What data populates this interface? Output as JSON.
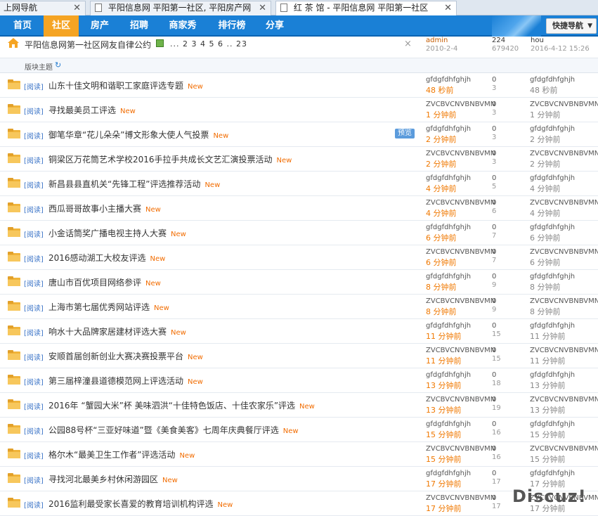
{
  "browser": {
    "tabs": [
      {
        "label": "上网导航"
      },
      {
        "label": "平阳信息网 平阳第一社区, 平阳房产网"
      },
      {
        "label": "红 茶 馆 - 平阳信息网 平阳第一社区"
      }
    ]
  },
  "nav": {
    "items": [
      "首页",
      "社区",
      "房产",
      "招聘",
      "商家秀",
      "排行榜",
      "分享"
    ],
    "active": "社区",
    "quick_nav": "快捷导航"
  },
  "announcement": {
    "title": "平阳信息网第一社区网友自律公约",
    "pager": "... 2 3 4 5 6 .. 23",
    "close": "×",
    "author": "admin",
    "date": "2010-2-4",
    "replies": "224",
    "views": "679420",
    "last_by": "hou",
    "last_time": "2016-4-12 15:26"
  },
  "section": {
    "label": "版块主题"
  },
  "new_label": "New",
  "preview_label": "预览",
  "threads": [
    {
      "cat": "[阅读]",
      "title": "山东十佳文明和谐职工家庭评选专题",
      "author": "gfdgfdhfghjh",
      "atime": "48 秒前",
      "replies": "0",
      "views": "3",
      "last_by": "gfdgfdhfghjh",
      "last_time": "48 秒前"
    },
    {
      "cat": "[阅读]",
      "title": "寻找最美员工评选",
      "author": "ZVCBVCNVBNBVMN",
      "atime": "1 分钟前",
      "replies": "0",
      "views": "3",
      "last_by": "ZVCBVCNVBNBVMN",
      "last_time": "1 分钟前"
    },
    {
      "cat": "[阅读]",
      "title": "御笔华章“花儿朵朵”博文形象大使人气投票",
      "author": "gfdgfdhfghjh",
      "atime": "2 分钟前",
      "replies": "0",
      "views": "3",
      "last_by": "gfdgfdhfghjh",
      "last_time": "2 分钟前",
      "preview": true
    },
    {
      "cat": "[阅读]",
      "title": "铜梁区万花筒艺术学校2016手拉手共成长文艺汇演投票活动",
      "author": "ZVCBVCNVBNBVMN",
      "atime": "2 分钟前",
      "replies": "0",
      "views": "3",
      "last_by": "ZVCBVCNVBNBVMN",
      "last_time": "2 分钟前"
    },
    {
      "cat": "[阅读]",
      "title": "新昌县县直机关“先锋工程”评选推荐活动",
      "author": "gfdgfdhfghjh",
      "atime": "4 分钟前",
      "replies": "0",
      "views": "5",
      "last_by": "gfdgfdhfghjh",
      "last_time": "4 分钟前"
    },
    {
      "cat": "[阅读]",
      "title": "西瓜哥哥故事小主播大赛",
      "author": "ZVCBVCNVBNBVMN",
      "atime": "4 分钟前",
      "replies": "0",
      "views": "6",
      "last_by": "ZVCBVCNVBNBVMN",
      "last_time": "4 分钟前"
    },
    {
      "cat": "[阅读]",
      "title": "小金话筒奖广播电视主持人大赛",
      "author": "gfdgfdhfghjh",
      "atime": "6 分钟前",
      "replies": "0",
      "views": "7",
      "last_by": "gfdgfdhfghjh",
      "last_time": "6 分钟前"
    },
    {
      "cat": "[阅读]",
      "title": "2016感动湖工大校友评选",
      "author": "ZVCBVCNVBNBVMN",
      "atime": "6 分钟前",
      "replies": "0",
      "views": "7",
      "last_by": "ZVCBVCNVBNBVMN",
      "last_time": "6 分钟前"
    },
    {
      "cat": "[阅读]",
      "title": "唐山市百优项目网络参评",
      "author": "gfdgfdhfghjh",
      "atime": "8 分钟前",
      "replies": "0",
      "views": "9",
      "last_by": "gfdgfdhfghjh",
      "last_time": "8 分钟前"
    },
    {
      "cat": "[阅读]",
      "title": "上海市第七届优秀网站评选",
      "author": "ZVCBVCNVBNBVMN",
      "atime": "8 分钟前",
      "replies": "0",
      "views": "9",
      "last_by": "ZVCBVCNVBNBVMN",
      "last_time": "8 分钟前"
    },
    {
      "cat": "[阅读]",
      "title": "响水十大品牌家居建材评选大赛",
      "author": "gfdgfdhfghjh",
      "atime": "11 分钟前",
      "replies": "0",
      "views": "15",
      "last_by": "gfdgfdhfghjh",
      "last_time": "11 分钟前"
    },
    {
      "cat": "[阅读]",
      "title": "安顺首届创新创业大赛决赛投票平台",
      "author": "ZVCBVCNVBNBVMN",
      "atime": "11 分钟前",
      "replies": "0",
      "views": "15",
      "last_by": "ZVCBVCNVBNBVMN",
      "last_time": "11 分钟前"
    },
    {
      "cat": "[阅读]",
      "title": "第三届梓潼县道德模范网上评选活动",
      "author": "gfdgfdhfghjh",
      "atime": "13 分钟前",
      "replies": "0",
      "views": "18",
      "last_by": "gfdgfdhfghjh",
      "last_time": "13 分钟前"
    },
    {
      "cat": "[阅读]",
      "title": "2016年 “蟹园大米”杯 美味泗洪“十佳特色饭店、十佳农家乐”评选",
      "author": "ZVCBVCNVBNBVMN",
      "atime": "13 分钟前",
      "replies": "0",
      "views": "19",
      "last_by": "ZVCBVCNVBNBVMN",
      "last_time": "13 分钟前"
    },
    {
      "cat": "[阅读]",
      "title": "公园88号杯“三亚好味道”暨《美食美客》七周年庆典餐厅评选",
      "author": "gfdgfdhfghjh",
      "atime": "15 分钟前",
      "replies": "0",
      "views": "16",
      "last_by": "gfdgfdhfghjh",
      "last_time": "15 分钟前"
    },
    {
      "cat": "[阅读]",
      "title": "格尔木“最美卫生工作者”评选活动",
      "author": "ZVCBVCNVBNBVMN",
      "atime": "15 分钟前",
      "replies": "0",
      "views": "16",
      "last_by": "ZVCBVCNVBNBVMN",
      "last_time": "15 分钟前"
    },
    {
      "cat": "[阅读]",
      "title": "寻找河北最美乡村休闲游园区",
      "author": "gfdgfdhfghjh",
      "atime": "17 分钟前",
      "replies": "0",
      "views": "17",
      "last_by": "gfdgfdhfghjh",
      "last_time": "17 分钟前"
    },
    {
      "cat": "[阅读]",
      "title": "2016监利最受家长喜爱的教育培训机构评选",
      "author": "ZVCBVCNVBNBVMN",
      "atime": "17 分钟前",
      "replies": "0",
      "views": "17",
      "last_by": "ZVCBVCNVBNBVMN",
      "last_time": "17 分钟前"
    }
  ],
  "watermark": "Discuz!",
  "icons": {
    "home": "home-icon",
    "folder": "folder-icon",
    "refresh": "refresh-icon",
    "image": "image-icon",
    "doc": "document-icon",
    "close": "close-icon"
  },
  "colors": {
    "nav_bg": "#1a80d6",
    "nav_active": "#f5a423",
    "new_tag": "#f26c00",
    "category": "#3b74c7"
  }
}
